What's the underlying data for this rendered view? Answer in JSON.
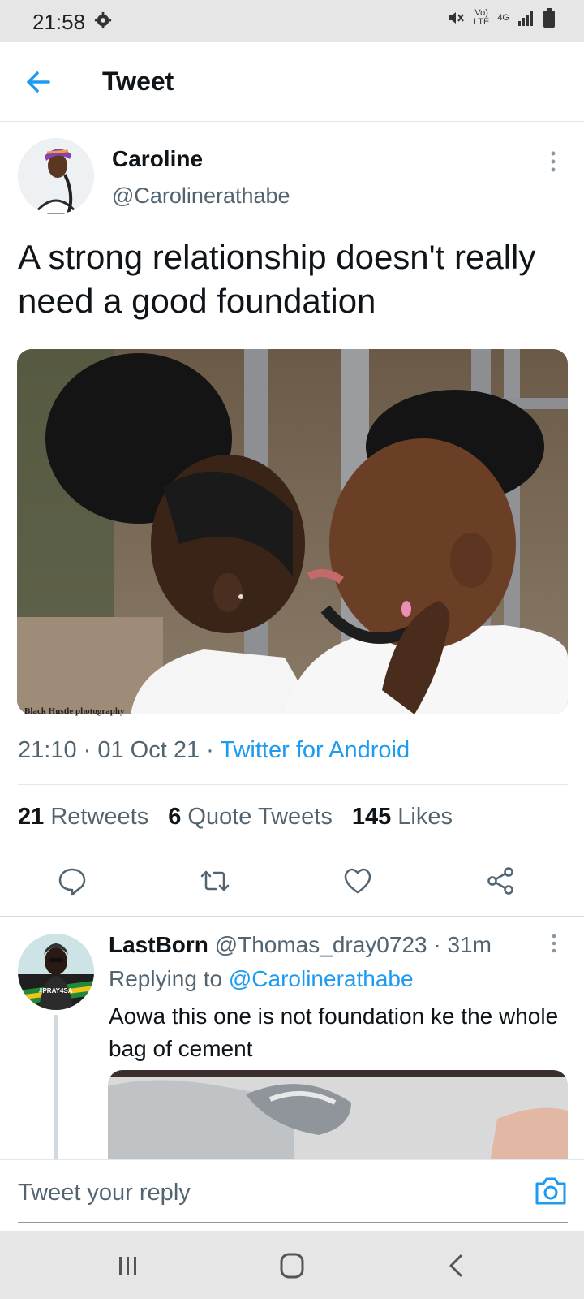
{
  "status_bar": {
    "time": "21:58",
    "lte_label": "Vo)\nLTE",
    "network": "4G"
  },
  "header": {
    "title": "Tweet"
  },
  "tweet": {
    "author_name": "Caroline",
    "author_handle": "@Carolinerathabe",
    "text": "A strong relationship doesn't really need a good foundation",
    "photo_credit": "Black Hustle photography",
    "time": "21:10",
    "date": "01 Oct 21",
    "source": "Twitter for Android",
    "separator": " · "
  },
  "stats": {
    "retweets_count": "21",
    "retweets_label": "Retweets",
    "quotes_count": "6",
    "quotes_label": "Quote Tweets",
    "likes_count": "145",
    "likes_label": "Likes"
  },
  "reply": {
    "name": "LastBorn",
    "handle": "@Thomas_dray0723",
    "time": "31m",
    "replying_prefix": "Replying to",
    "replying_to": "@Carolinerathabe",
    "text": "Aowa this one is not foundation ke the whole bag of cement",
    "avatar_badge": "#PRAY4SA"
  },
  "composer": {
    "placeholder": "Tweet your reply"
  },
  "colors": {
    "accent": "#1d9bf0",
    "secondary_text": "#536471",
    "primary_text": "#0f1419"
  }
}
